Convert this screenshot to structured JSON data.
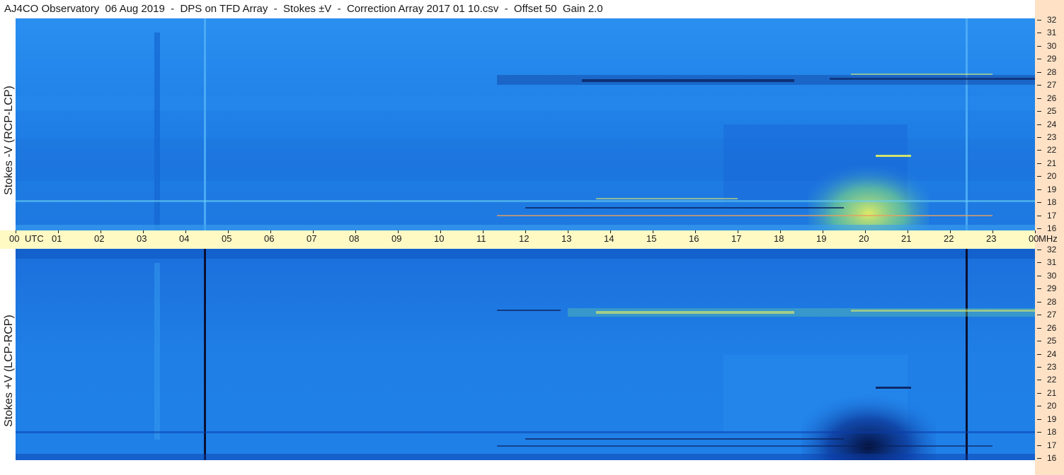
{
  "title": "AJ4CO Observatory  06 Aug 2019  -  DPS on TFD Array  -  Stokes ±V  -  Correction Array 2017 01 10.csv  -  Offset 50  Gain 2.0",
  "panels": {
    "top": {
      "label": "Stokes -V (RCP-LCP)"
    },
    "bottom": {
      "label": "Stokes +V (LCP-RCP)"
    }
  },
  "time_axis": {
    "labels": [
      "00",
      "01",
      "02",
      "03",
      "04",
      "05",
      "06",
      "07",
      "08",
      "09",
      "10",
      "11",
      "12",
      "13",
      "14",
      "15",
      "16",
      "17",
      "18",
      "19",
      "20",
      "21",
      "22",
      "23",
      "00"
    ],
    "utc_label": "UTC",
    "unit_label": "MHz"
  },
  "frequency_axis": {
    "labels": [
      "32",
      "31",
      "30",
      "29",
      "28",
      "27",
      "26",
      "25",
      "24",
      "23",
      "22",
      "21",
      "20",
      "19",
      "18",
      "17",
      "16"
    ]
  },
  "colors": {
    "background_blue": "#1f7fe6",
    "deep_blue": "#0a3aa8",
    "burst_yellow": "#e8f060",
    "axis_bar": "#fff9c4",
    "right_strip": "#ffe2c6"
  }
}
